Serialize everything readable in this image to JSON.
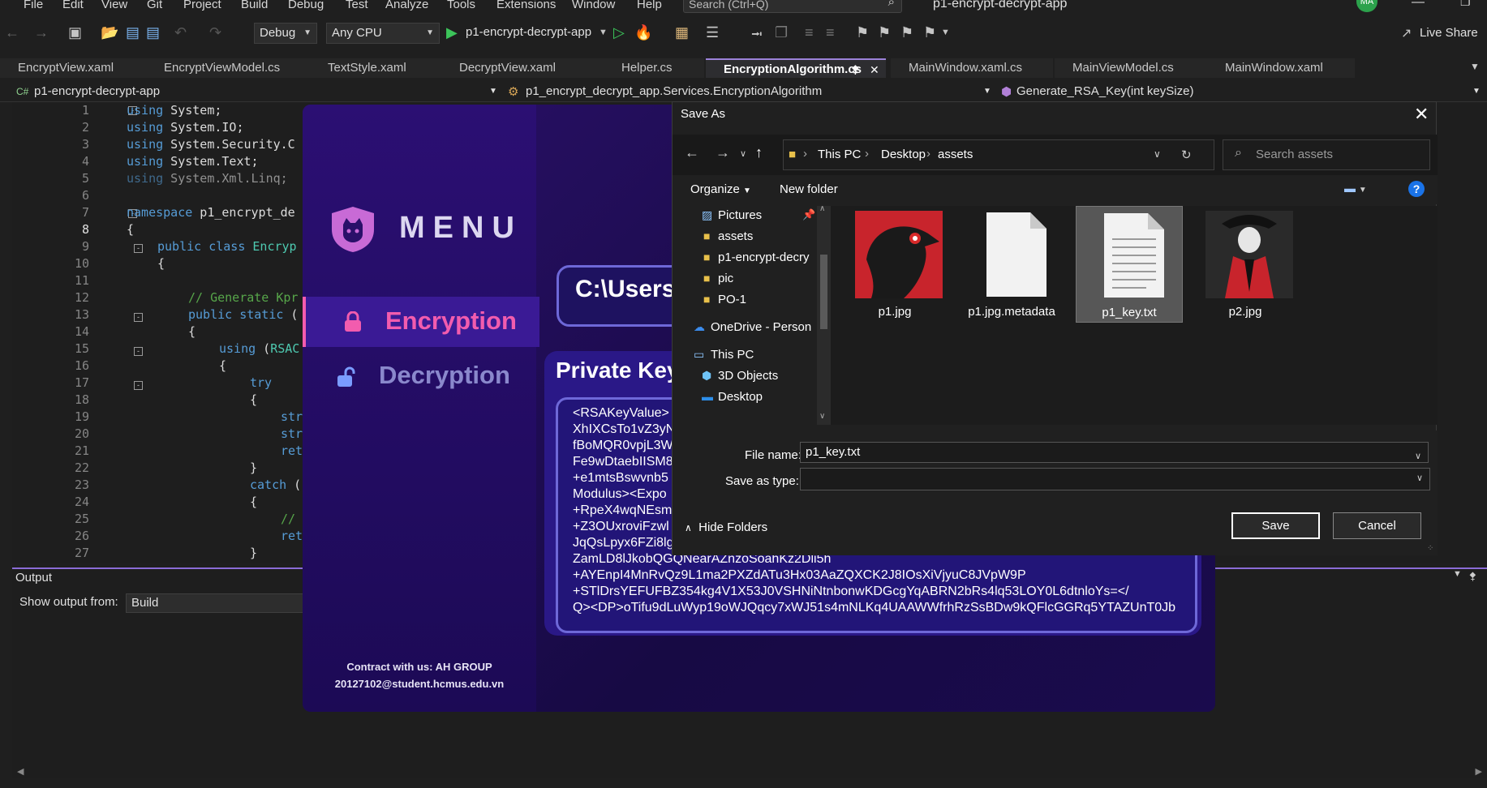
{
  "vs": {
    "menu": [
      "File",
      "Edit",
      "View",
      "Git",
      "Project",
      "Build",
      "Debug",
      "Test",
      "Analyze",
      "Tools",
      "Extensions",
      "Window",
      "Help"
    ],
    "search_placeholder": "Search (Ctrl+Q)",
    "title": "p1-encrypt-decrypt-app",
    "avatar": "MA",
    "toolbar": {
      "config": "Debug",
      "platform": "Any CPU",
      "run_target": "p1-encrypt-decrypt-app",
      "live_share": "Live Share"
    },
    "tabs": [
      "EncryptView.xaml",
      "EncryptViewModel.cs",
      "TextStyle.xaml",
      "DecryptView.xaml",
      "Helper.cs",
      "EncryptionAlgorithm.cs",
      "MainWindow.xaml.cs",
      "MainViewModel.cs",
      "MainWindow.xaml"
    ],
    "navbar": {
      "project": "p1-encrypt-decrypt-app",
      "class": "p1_encrypt_decrypt_app.Services.EncryptionAlgorithm",
      "member": "Generate_RSA_Key(int keySize)"
    },
    "line_numbers": [
      "1",
      "2",
      "3",
      "4",
      "5",
      "6",
      "7",
      "8",
      "9",
      "10",
      "11",
      "12",
      "13",
      "14",
      "15",
      "16",
      "17",
      "18",
      "19",
      "20",
      "21",
      "22",
      "23",
      "24",
      "25",
      "26",
      "27"
    ],
    "output": {
      "title": "Output",
      "show_from": "Show output from:",
      "source": "Build"
    }
  },
  "app": {
    "menu_title": "MENU",
    "nav_encryption": "Encryption",
    "nav_decryption": "Decryption",
    "contact_line1": "Contract with us: AH GROUP",
    "contact_line2": "20127102@student.hcmus.edu.vn",
    "path_value": "C:\\Users\\h",
    "private_key_title": "Private Key",
    "private_key_lines": [
      "<RSAKeyValue>",
      "XhIXCsTo1vZ3yN",
      "fBoMQR0vpjL3W",
      "Fe9wDtaebIISM8",
      "+e1mtsBswvnb5",
      "Modulus><Expo",
      "+RpeX4wqNEsm",
      "+Z3OUxroviFzwl",
      "JqQsLpyx6FZi8lg",
      "ZamLD8lJkobQGQNearAZnzoSoahKz2Dli5h",
      "+AYEnpI4MnRvQz9L1ma2PXZdATu3Hx03AaZQXCK2J8IOsXiVjyuC8JVpW9P",
      "+STlDrsYEFUFBZ354kg4V1X53J0VSHNiNtnbonwKDGcgYqABRN2bRs4lq53LOY0L6dtnloYs=</",
      "Q><DP>oTifu9dLuWyp19oWJQqcy7xWJ51s4mNLKq4UAAWWfrhRzSsBDw9kQFlcGGRq5YTAZUnT0Jb"
    ]
  },
  "dialog": {
    "title": "Save As",
    "breadcrumb": [
      "This PC",
      "Desktop",
      "assets"
    ],
    "search_placeholder": "Search assets",
    "organize": "Organize",
    "new_folder": "New folder",
    "help": "?",
    "tree": [
      "Pictures",
      "assets",
      "p1-encrypt-decry",
      "pic",
      "PO-1",
      "OneDrive - Person",
      "This PC",
      "3D Objects",
      "Desktop"
    ],
    "files": [
      "p1.jpg",
      "p1.jpg.metadata",
      "p1_key.txt",
      "p2.jpg"
    ],
    "file_name_label": "File name:",
    "file_name_value": "p1_key.txt",
    "save_type_label": "Save as type:",
    "hide_folders": "Hide Folders",
    "save": "Save",
    "cancel": "Cancel"
  }
}
